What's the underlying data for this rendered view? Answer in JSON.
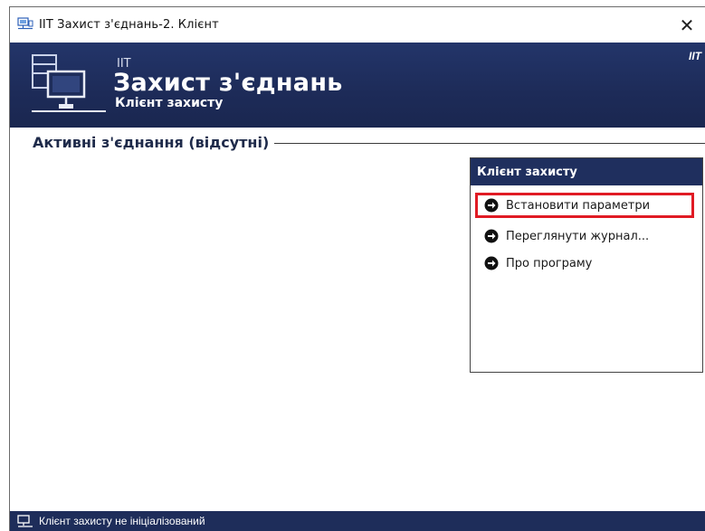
{
  "window": {
    "title": "IIT Захист з'єднань-2. Клієнт",
    "close_glyph": "✕"
  },
  "banner": {
    "small_label": "IIT",
    "title": "Захист з'єднань",
    "subtitle": "Клієнт захисту",
    "brand": "IIT",
    "bg_color": "#1e2d5a"
  },
  "main": {
    "section_title": "Активні з'єднання (відсутні)"
  },
  "task_panel": {
    "header": "Клієнт захисту",
    "items": [
      {
        "label": "Встановити параметри",
        "icon": "arrow-right-circle-icon",
        "highlighted": true
      },
      {
        "label": "Переглянути журнал...",
        "icon": "arrow-right-circle-icon"
      },
      {
        "label": "Про програму",
        "icon": "arrow-right-circle-icon"
      }
    ],
    "highlight_color": "#e01b24"
  },
  "statusbar": {
    "text": "Клієнт захисту не ініціалізований",
    "icon": "computer-network-icon"
  }
}
